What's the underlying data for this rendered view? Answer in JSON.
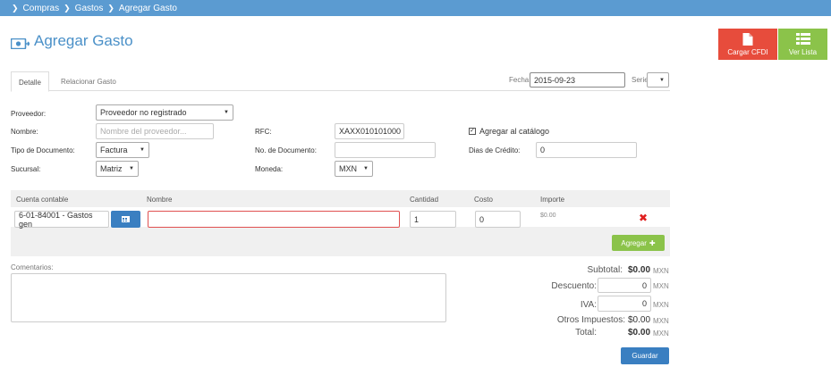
{
  "breadcrumb": [
    "Compras",
    "Gastos",
    "Agregar Gasto"
  ],
  "page_title": "Agregar Gasto",
  "actions": {
    "cargar_cfdi": "Cargar CFDI",
    "ver_lista": "Ver Lista"
  },
  "tabs": [
    "Detalle",
    "Relacionar Gasto"
  ],
  "fecha": {
    "label": "Fecha:",
    "value": "2015-09-23"
  },
  "serie": {
    "label": "Serie",
    "value": ""
  },
  "form": {
    "proveedor": {
      "label": "Proveedor:",
      "value": "Proveedor no registrado"
    },
    "nombre": {
      "label": "Nombre:",
      "placeholder": "Nombre del proveedor..."
    },
    "rfc": {
      "label": "RFC:",
      "value": "XAXX010101000"
    },
    "agregar_catalogo": {
      "label": "Agregar al catálogo",
      "checked": true
    },
    "tipo_documento": {
      "label": "Tipo de Documento:",
      "value": "Factura"
    },
    "no_documento": {
      "label": "No. de Documento:",
      "value": ""
    },
    "dias_credito": {
      "label": "Dias de Crédito:",
      "value": "0"
    },
    "sucursal": {
      "label": "Sucursal:",
      "value": "Matriz"
    },
    "moneda": {
      "label": "Moneda:",
      "value": "MXN"
    }
  },
  "grid": {
    "headers": [
      "Cuenta contable",
      "Nombre",
      "Cantidad",
      "Costo",
      "Importe"
    ],
    "row": {
      "cuenta": "6-01-84001 - Gastos gen",
      "nombre": "",
      "cantidad": "1",
      "costo": "0",
      "importe": "$0.00"
    },
    "add_label": "Agregar"
  },
  "comentarios": {
    "label": "Comentarios:"
  },
  "totals": {
    "subtotal": {
      "label": "Subtotal:",
      "value": "$0.00"
    },
    "descuento": {
      "label": "Descuento:",
      "value": "0"
    },
    "iva": {
      "label": "IVA:",
      "value": "0"
    },
    "otros": {
      "label": "Otros Impuestos:",
      "value": "$0.00"
    },
    "total": {
      "label": "Total:",
      "value": "$0.00"
    },
    "currency": "MXN"
  },
  "save_label": "Guardar",
  "colors": {
    "primary": "#3a7fc1",
    "danger": "#e74c3c",
    "success": "#8bc34a",
    "header": "#5b9bd1"
  }
}
